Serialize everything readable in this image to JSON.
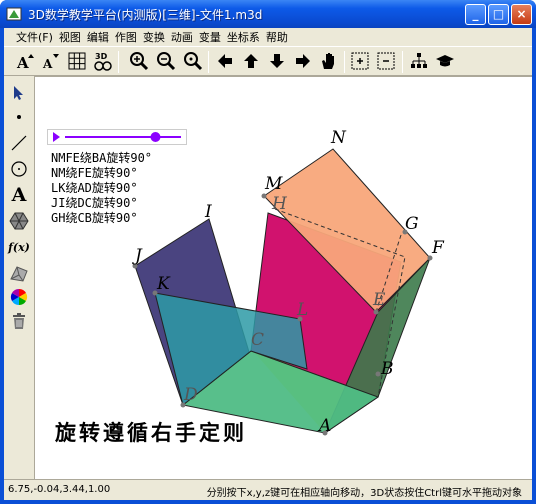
{
  "window": {
    "title": "3D数学教学平台(内测版)[三维]-文件1.m3d",
    "minimize_label": "_",
    "maximize_label": "□",
    "close_label": "×"
  },
  "menu": {
    "items": [
      "文件(F)",
      "视图",
      "编辑",
      "作图",
      "变换",
      "动画",
      "变量",
      "坐标系",
      "帮助"
    ]
  },
  "toolbar": {
    "buttons": [
      "text-size-up-icon",
      "text-size-down-icon",
      "grid-icon",
      "3d-view-icon",
      "zoom-in-icon",
      "zoom-out-icon",
      "zoom-reset-icon",
      "move-left-icon",
      "move-up-icon",
      "move-down-icon",
      "move-right-icon",
      "pan-hand-icon",
      "zoom-box-icon",
      "zoom-box-out-icon",
      "tree-icon",
      "graduation-cap-icon"
    ],
    "label_3d": "3D"
  },
  "tools": {
    "buttons": [
      "select-arrow-icon",
      "point-icon",
      "segment-icon",
      "circle-icon",
      "text-tool-icon",
      "polygon-icon",
      "function-icon",
      "solid-icon",
      "color-wheel-icon",
      "trash-icon"
    ],
    "text_label": "A",
    "function_label": "f(x)"
  },
  "canvas": {
    "slider_level": 0.78,
    "rotations": [
      "NMFE绕BA旋转90°",
      "NM绕FE旋转90°",
      "LK绕AD旋转90°",
      "JI绕DC旋转90°",
      "GH绕CB旋转90°"
    ],
    "rule": "旋转遵循右手定则",
    "points": {
      "N": "N",
      "M": "M",
      "H": "H",
      "G": "G",
      "F": "F",
      "E": "E",
      "I": "I",
      "J": "J",
      "K": "K",
      "L": "L",
      "D": "D",
      "C": "C",
      "B": "B",
      "A": "A"
    }
  },
  "status": {
    "coords": "6.75,-0.04,3.44,1.00",
    "hint": "分别按下x,y,z键可在相应轴向移动，3D状态按住Ctrl键可水平拖动对象"
  },
  "colors": {
    "title_bar": "#0a4ad0",
    "slider": "#8b00ff",
    "face_salmon": "#f8a77a",
    "face_magenta": "#d1126e",
    "face_purple": "#4a4480",
    "face_teal": "#2d9aa6",
    "face_green": "#4fbc85",
    "face_darkgreen": "#3c7a4a",
    "face_yellow": "#ffff33"
  }
}
